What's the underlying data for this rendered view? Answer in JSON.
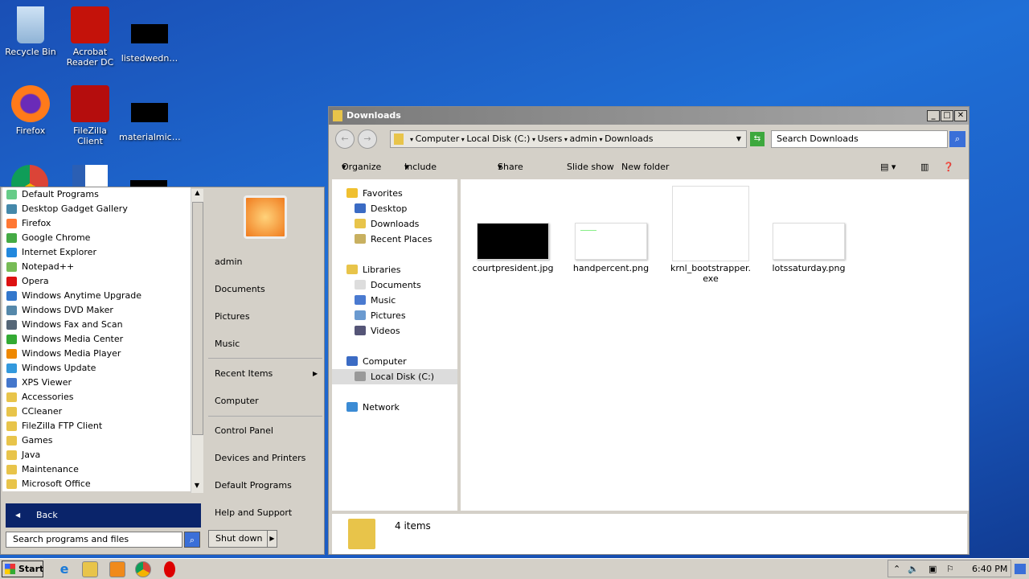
{
  "desktop": {
    "icons": [
      {
        "label": "Recycle Bin",
        "icon": "recycle-bin-icon"
      },
      {
        "label": "Acrobat Reader DC",
        "icon": "acrobat-icon"
      },
      {
        "label": "listedwedn…",
        "icon": "black-thumbnail"
      },
      {
        "label": "Firefox",
        "icon": "firefox-icon"
      },
      {
        "label": "FileZilla Client",
        "icon": "filezilla-icon"
      },
      {
        "label": "materialmic…",
        "icon": "black-thumbnail"
      }
    ]
  },
  "start_menu": {
    "programs": [
      "Default Programs",
      "Desktop Gadget Gallery",
      "Firefox",
      "Google Chrome",
      "Internet Explorer",
      "Notepad++",
      "Opera",
      "Windows Anytime Upgrade",
      "Windows DVD Maker",
      "Windows Fax and Scan",
      "Windows Media Center",
      "Windows Media Player",
      "Windows Update",
      "XPS Viewer",
      "Accessories",
      "CCleaner",
      "FileZilla FTP Client",
      "Games",
      "Java",
      "Maintenance",
      "Microsoft Office"
    ],
    "right": [
      "admin",
      "Documents",
      "Pictures",
      "Music",
      "Recent Items",
      "Computer",
      "Control Panel",
      "Devices and Printers",
      "Default Programs",
      "Help and Support"
    ],
    "back": "Back",
    "search_placeholder": "Search programs and files",
    "shutdown": "Shut down"
  },
  "explorer": {
    "title": "Downloads",
    "breadcrumb": [
      "Computer",
      "Local Disk (C:)",
      "Users",
      "admin",
      "Downloads"
    ],
    "search_placeholder": "Search Downloads",
    "toolbar": [
      "Organize",
      "Include in library",
      "Share with",
      "Slide show",
      "New folder"
    ],
    "nav": {
      "favorites": "Favorites",
      "fav_items": [
        "Desktop",
        "Downloads",
        "Recent Places"
      ],
      "libraries": "Libraries",
      "lib_items": [
        "Documents",
        "Music",
        "Pictures",
        "Videos"
      ],
      "computer": "Computer",
      "local_disk": "Local Disk (C:)",
      "network": "Network"
    },
    "files": [
      {
        "name": "courtpresident.jpg"
      },
      {
        "name": "handpercent.png"
      },
      {
        "name": "krnl_bootstrapper.",
        "name2": "exe"
      },
      {
        "name": "lotssaturday.png"
      }
    ],
    "status": "4 items"
  },
  "taskbar": {
    "start": "Start",
    "clock": "6:40 PM"
  }
}
